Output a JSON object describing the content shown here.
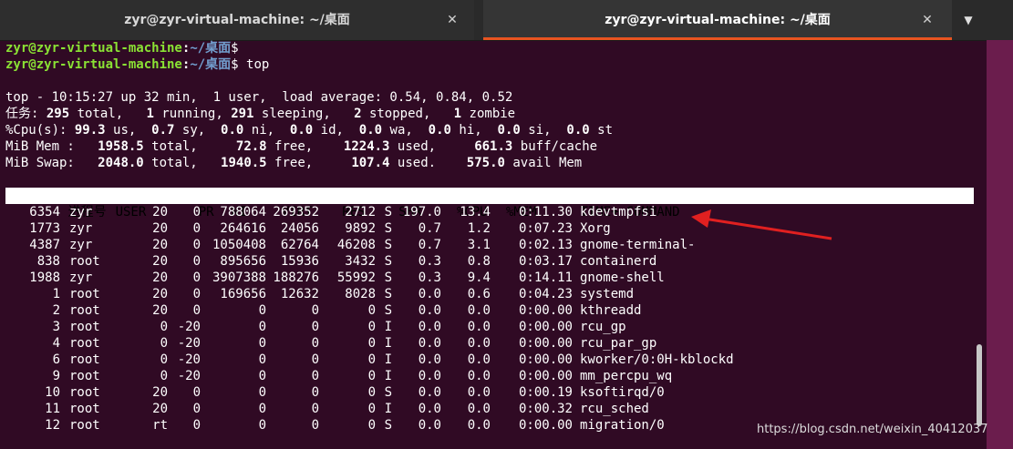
{
  "tabs": [
    {
      "title": "zyr@zyr-virtual-machine: ~/桌面",
      "close": "✕"
    },
    {
      "title": "zyr@zyr-virtual-machine: ~/桌面",
      "close": "✕"
    }
  ],
  "dropdown_glyph": "▼",
  "prompts": [
    {
      "user": "zyr@zyr-virtual-machine",
      "colon": ":",
      "path": "~/桌面",
      "suffix": "$"
    },
    {
      "user": "zyr@zyr-virtual-machine",
      "colon": ":",
      "path": "~/桌面",
      "suffix": "$ top"
    }
  ],
  "summary": {
    "line1": "top - 10:15:27 up 32 min,  1 user,  load average: 0.54, 0.84, 0.52",
    "tasks": {
      "label": "任务:",
      "total": "295",
      "running": "1",
      "sleeping": "291",
      "stopped": "2",
      "zombie": "1"
    },
    "cpu": {
      "label": "%Cpu(s):",
      "us": "99.3",
      "sy": "0.7",
      "ni": "0.0",
      "id": "0.0",
      "wa": "0.0",
      "hi": "0.0",
      "si": "0.0",
      "st": "0.0"
    },
    "mem": {
      "label": "MiB Mem :",
      "total": "1958.5",
      "free": "72.8",
      "used": "1224.3",
      "buff": "661.3"
    },
    "swap": {
      "label": "MiB Swap:",
      "total": "2048.0",
      "free": "1940.5",
      "used": "107.4",
      "avail": "575.0"
    }
  },
  "columns": [
    "进程号",
    "USER",
    "PR",
    "NI",
    "VIRT",
    "RES",
    "SHR",
    "",
    "%CPU",
    "%MEM",
    "TIME+",
    "COMMAND"
  ],
  "processes": [
    {
      "pid": "6354",
      "user": "zyr",
      "pr": "20",
      "ni": "0",
      "virt": "788064",
      "res": "269352",
      "shr": "2712",
      "s": "S",
      "cpu": "197.0",
      "mem": "13.4",
      "time": "0:11.30",
      "cmd": "kdevtmpfsi"
    },
    {
      "pid": "1773",
      "user": "zyr",
      "pr": "20",
      "ni": "0",
      "virt": "264616",
      "res": "24056",
      "shr": "9892",
      "s": "S",
      "cpu": "0.7",
      "mem": "1.2",
      "time": "0:07.23",
      "cmd": "Xorg"
    },
    {
      "pid": "4387",
      "user": "zyr",
      "pr": "20",
      "ni": "0",
      "virt": "1050408",
      "res": "62764",
      "shr": "46208",
      "s": "S",
      "cpu": "0.7",
      "mem": "3.1",
      "time": "0:02.13",
      "cmd": "gnome-terminal-"
    },
    {
      "pid": "838",
      "user": "root",
      "pr": "20",
      "ni": "0",
      "virt": "895656",
      "res": "15936",
      "shr": "3432",
      "s": "S",
      "cpu": "0.3",
      "mem": "0.8",
      "time": "0:03.17",
      "cmd": "containerd"
    },
    {
      "pid": "1988",
      "user": "zyr",
      "pr": "20",
      "ni": "0",
      "virt": "3907388",
      "res": "188276",
      "shr": "55992",
      "s": "S",
      "cpu": "0.3",
      "mem": "9.4",
      "time": "0:14.11",
      "cmd": "gnome-shell"
    },
    {
      "pid": "1",
      "user": "root",
      "pr": "20",
      "ni": "0",
      "virt": "169656",
      "res": "12632",
      "shr": "8028",
      "s": "S",
      "cpu": "0.0",
      "mem": "0.6",
      "time": "0:04.23",
      "cmd": "systemd"
    },
    {
      "pid": "2",
      "user": "root",
      "pr": "20",
      "ni": "0",
      "virt": "0",
      "res": "0",
      "shr": "0",
      "s": "S",
      "cpu": "0.0",
      "mem": "0.0",
      "time": "0:00.00",
      "cmd": "kthreadd"
    },
    {
      "pid": "3",
      "user": "root",
      "pr": "0",
      "ni": "-20",
      "virt": "0",
      "res": "0",
      "shr": "0",
      "s": "I",
      "cpu": "0.0",
      "mem": "0.0",
      "time": "0:00.00",
      "cmd": "rcu_gp"
    },
    {
      "pid": "4",
      "user": "root",
      "pr": "0",
      "ni": "-20",
      "virt": "0",
      "res": "0",
      "shr": "0",
      "s": "I",
      "cpu": "0.0",
      "mem": "0.0",
      "time": "0:00.00",
      "cmd": "rcu_par_gp"
    },
    {
      "pid": "6",
      "user": "root",
      "pr": "0",
      "ni": "-20",
      "virt": "0",
      "res": "0",
      "shr": "0",
      "s": "I",
      "cpu": "0.0",
      "mem": "0.0",
      "time": "0:00.00",
      "cmd": "kworker/0:0H-kblockd"
    },
    {
      "pid": "9",
      "user": "root",
      "pr": "0",
      "ni": "-20",
      "virt": "0",
      "res": "0",
      "shr": "0",
      "s": "I",
      "cpu": "0.0",
      "mem": "0.0",
      "time": "0:00.00",
      "cmd": "mm_percpu_wq"
    },
    {
      "pid": "10",
      "user": "root",
      "pr": "20",
      "ni": "0",
      "virt": "0",
      "res": "0",
      "shr": "0",
      "s": "S",
      "cpu": "0.0",
      "mem": "0.0",
      "time": "0:00.19",
      "cmd": "ksoftirqd/0"
    },
    {
      "pid": "11",
      "user": "root",
      "pr": "20",
      "ni": "0",
      "virt": "0",
      "res": "0",
      "shr": "0",
      "s": "I",
      "cpu": "0.0",
      "mem": "0.0",
      "time": "0:00.32",
      "cmd": "rcu_sched"
    },
    {
      "pid": "12",
      "user": "root",
      "pr": "rt",
      "ni": "0",
      "virt": "0",
      "res": "0",
      "shr": "0",
      "s": "S",
      "cpu": "0.0",
      "mem": "0.0",
      "time": "0:00.00",
      "cmd": "migration/0"
    }
  ],
  "watermark": "https://blog.csdn.net/weixin_40412037",
  "colors": {
    "terminal_bg": "#300a24",
    "prompt_user": "#8ae234",
    "prompt_path": "#729fcf",
    "active_tab_accent": "#e95420",
    "arrow": "#e02020"
  }
}
